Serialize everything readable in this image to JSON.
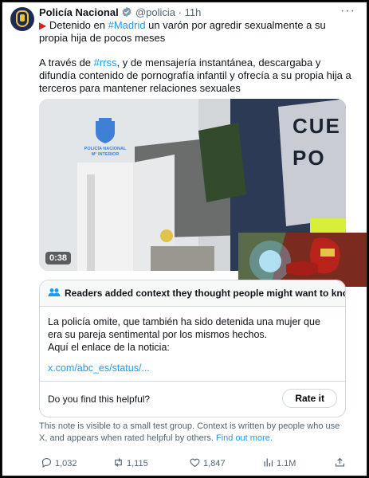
{
  "tweet": {
    "author_name": "Policía Nacional",
    "handle": "@policia",
    "separator": "·",
    "time": "11h",
    "flag": "▶",
    "line1_pre": "Detenido en ",
    "hashtag_madrid": "#Madrid",
    "line1_post": " un varón por agredir sexualmente a su propia hija de pocos meses",
    "line2_pre": "A través de ",
    "hashtag_rrss": "#rrss",
    "line2_post": ", y de mensajería instantánea, descargaba y difundía contenido de pornografía infantil y ofrecía a su propia hija a terceros para mantener relaciones sexuales"
  },
  "media": {
    "duration": "0:38",
    "badge_line1": "POLICÍA NACIONAL",
    "badge_line2": "M° INTERIOR",
    "vest_text": "CUE PO"
  },
  "notes": {
    "header": "Readers added context they thought people might want to know",
    "body": "La policía omite, que también ha sido detenida una mujer que era su pareja sentimental por los mismos hechos.\nAquí el enlace de la noticia:",
    "link": "x.com/abc_es/status/...",
    "helpful_question": "Do you find this helpful?",
    "rate_label": "Rate it"
  },
  "footnote": {
    "text": "This note is visible to a small test group. Context is written by people who use X, and appears when rated helpful by others. ",
    "link": "Find out more."
  },
  "actions": {
    "replies": "1,032",
    "reposts": "1,115",
    "likes": "1,847",
    "views": "1.1M"
  },
  "colors": {
    "accent": "#1d9bf0",
    "muted": "#536471",
    "border": "#cfd9de"
  }
}
